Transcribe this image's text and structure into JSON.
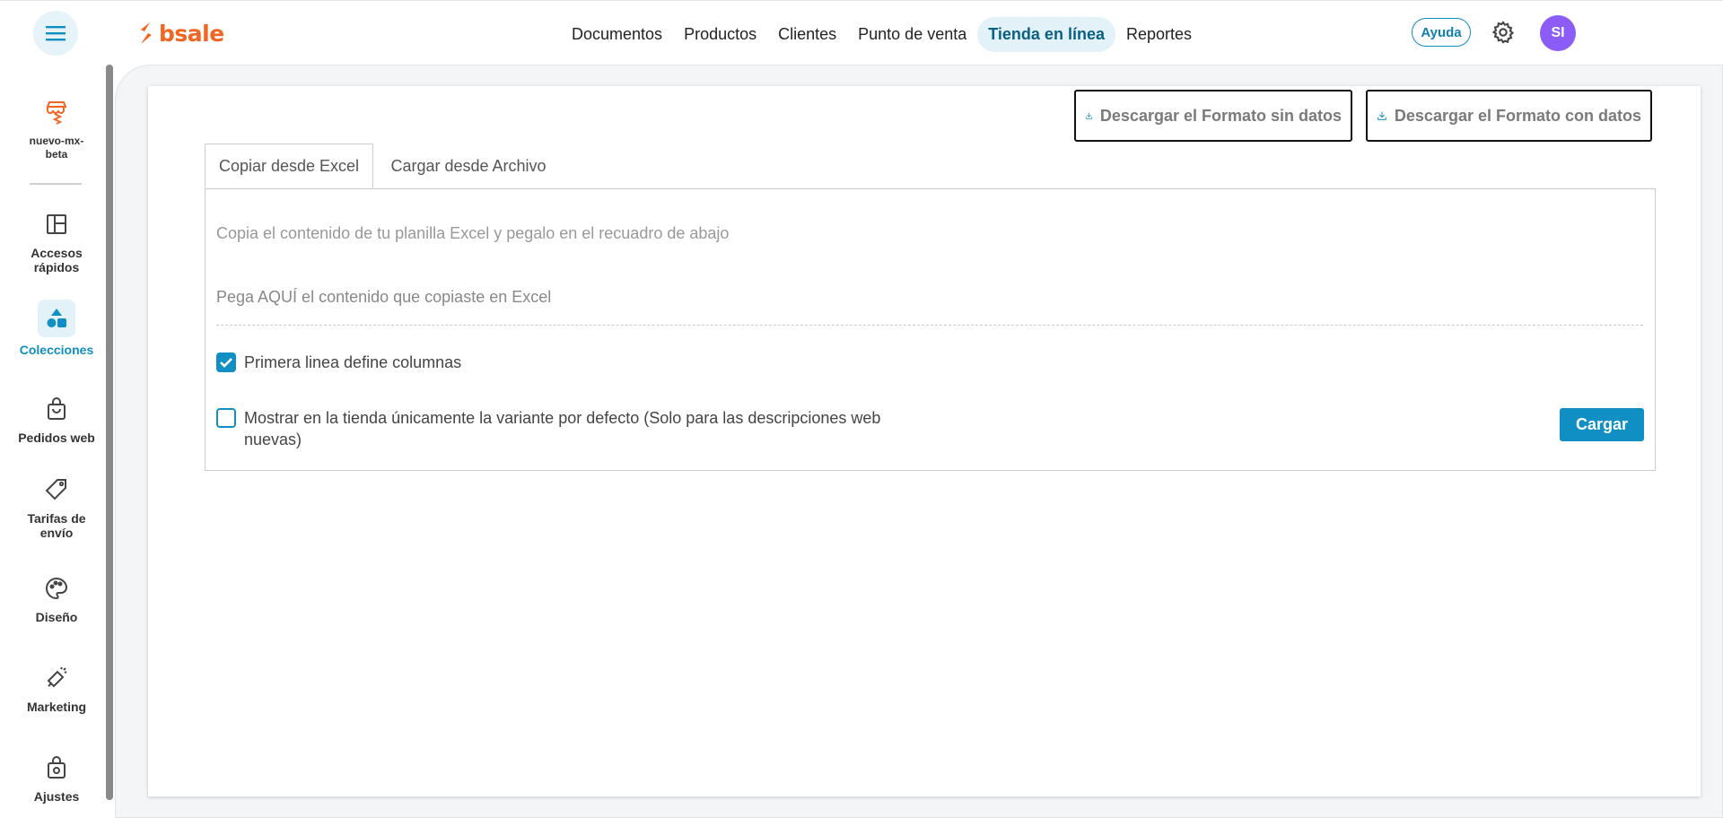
{
  "brand": {
    "name": "bsale",
    "color": "#f26522"
  },
  "topnav": {
    "items": [
      {
        "label": "Documentos"
      },
      {
        "label": "Productos"
      },
      {
        "label": "Clientes"
      },
      {
        "label": "Punto de venta"
      },
      {
        "label": "Tienda en línea",
        "active": true
      },
      {
        "label": "Reportes"
      }
    ],
    "help_label": "Ayuda",
    "avatar_initials": "SI"
  },
  "sidebar": {
    "store": {
      "name": "nuevo-mx-beta",
      "icon": "store-icon"
    },
    "items": [
      {
        "label": "Accesos rápidos",
        "icon": "layout-icon"
      },
      {
        "label": "Colecciones",
        "icon": "shapes-icon",
        "active": true
      },
      {
        "label": "Pedidos web",
        "icon": "shopping-bag-icon"
      },
      {
        "label": "Tarifas de envío",
        "icon": "tag-icon"
      },
      {
        "label": "Diseño",
        "icon": "palette-icon"
      },
      {
        "label": "Marketing",
        "icon": "megaphone-icon"
      },
      {
        "label": "Ajustes",
        "icon": "bag-settings-icon"
      }
    ]
  },
  "main": {
    "download_without": "Descargar el Formato sin datos",
    "download_with": "Descargar el Formato con datos",
    "tabs": [
      {
        "label": "Copiar desde Excel",
        "active": true
      },
      {
        "label": "Cargar desde Archivo"
      }
    ],
    "hint": "Copia el contenido de tu planilla Excel y pegalo en el recuadro de abajo",
    "paste_placeholder": "Pega AQUÍ el contenido que copiaste en Excel",
    "option_first_line": {
      "label": "Primera linea define columnas",
      "checked": true
    },
    "option_default_variant": {
      "label": "Mostrar en la tienda únicamente la variante por defecto (Solo para las descripciones web nuevas)",
      "checked": false
    },
    "submit_label": "Cargar"
  },
  "colors": {
    "accent": "#0f8fc4",
    "avatar": "#8b5cf6"
  }
}
